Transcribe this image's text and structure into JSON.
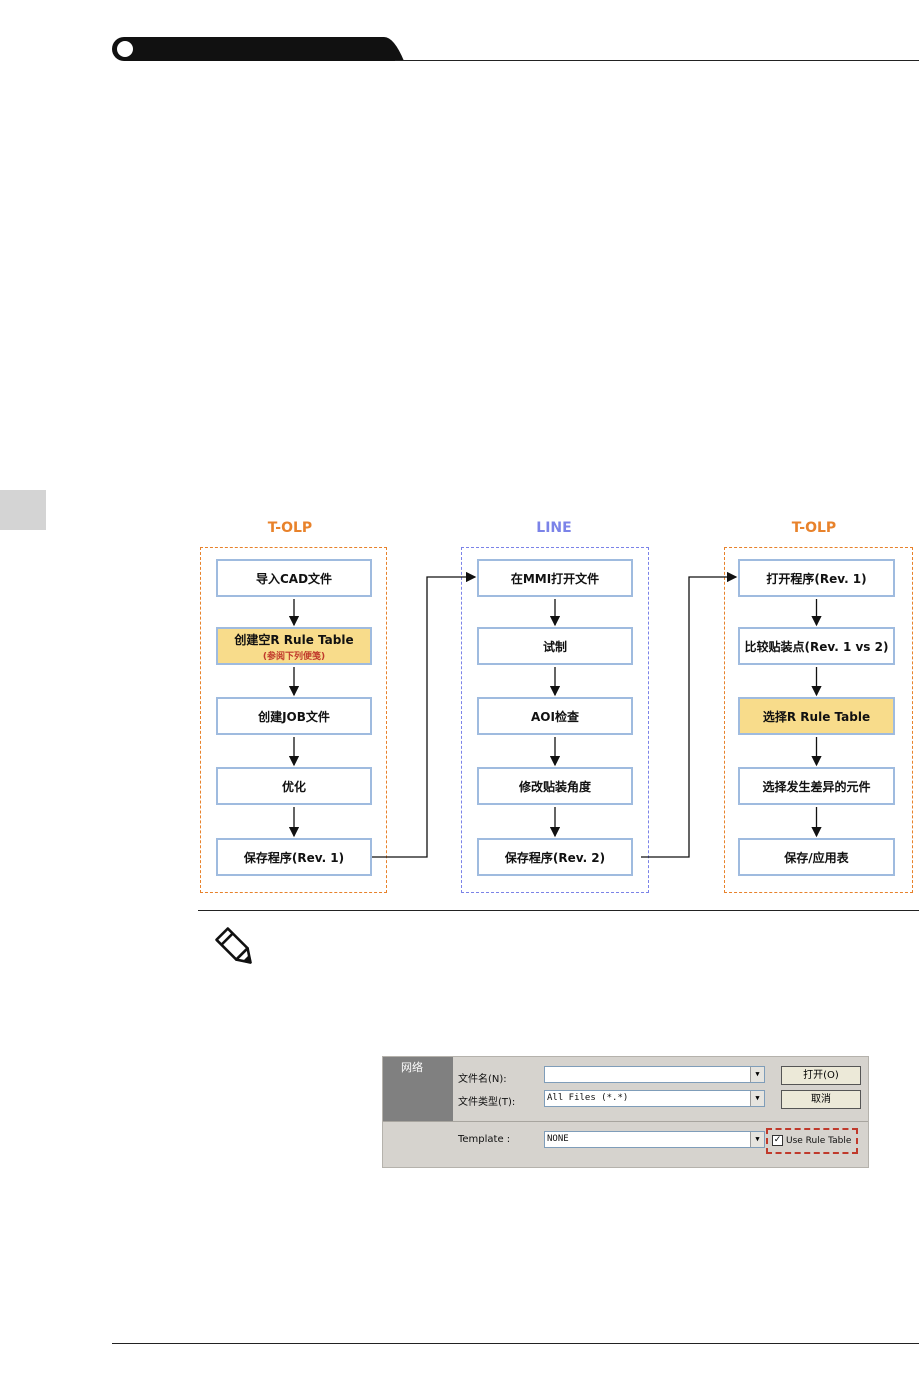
{
  "flow": {
    "columns": [
      {
        "title": "T-OLP",
        "color": "#e8822b",
        "steps": [
          {
            "label": "导入CAD文件",
            "note": "",
            "highlight": false
          },
          {
            "label": "创建空R Rule Table",
            "note": "(参阅下列便笺)",
            "highlight": true
          },
          {
            "label": "创建JOB文件",
            "note": "",
            "highlight": false
          },
          {
            "label": "优化",
            "note": "",
            "highlight": false
          },
          {
            "label": "保存程序(Rev. 1)",
            "note": "",
            "highlight": false
          }
        ]
      },
      {
        "title": "LINE",
        "color": "#7b83e8",
        "steps": [
          {
            "label": "在MMI打开文件",
            "note": "",
            "highlight": false
          },
          {
            "label": "试制",
            "note": "",
            "highlight": false
          },
          {
            "label": "AOI检查",
            "note": "",
            "highlight": false
          },
          {
            "label": "修改贴装角度",
            "note": "",
            "highlight": false
          },
          {
            "label": "保存程序(Rev. 2)",
            "note": "",
            "highlight": false
          }
        ]
      },
      {
        "title": "T-OLP",
        "color": "#e8822b",
        "steps": [
          {
            "label": "打开程序(Rev. 1)",
            "note": "",
            "highlight": false
          },
          {
            "label": "比较贴装点(Rev. 1 vs 2)",
            "note": "",
            "highlight": false
          },
          {
            "label": "选择R Rule Table",
            "note": "",
            "highlight": true
          },
          {
            "label": "选择发生差异的元件",
            "note": "",
            "highlight": false
          },
          {
            "label": "保存/应用表",
            "note": "",
            "highlight": false
          }
        ]
      }
    ],
    "box_border_color": "#9fbbdf",
    "highlight_color": "#f8dc8b"
  },
  "dialog": {
    "side_label": "网络",
    "filename_label": "文件名(N):",
    "filename_value": "",
    "filetype_label": "文件类型(T):",
    "filetype_value": "All Files (*.*)",
    "template_label": "Template :",
    "template_value": "NONE",
    "open_button": "打开(O)",
    "cancel_button": "取消",
    "checkbox_label": "Use Rule Table",
    "checkbox_checked": true
  },
  "icons": {
    "note": "pencil-note-icon"
  }
}
